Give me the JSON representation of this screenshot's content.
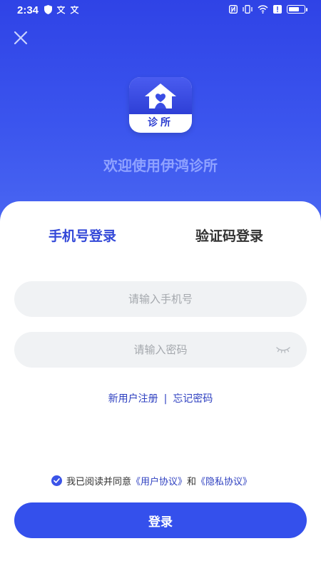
{
  "status_bar": {
    "time": "2:34",
    "left_icons": [
      "shield-icon",
      "translate-icon",
      "translate-icon"
    ],
    "right_icons": [
      "nfc-icon",
      "vibrate-icon",
      "wifi-icon",
      "alert-icon",
      "battery-icon"
    ]
  },
  "colors": {
    "brand_blue": "#3450ec",
    "tab_active": "#3348d8",
    "link": "#2d3fc0"
  },
  "header": {
    "close_icon": "close-icon",
    "logo_text": "诊所",
    "welcome": "欢迎使用伊鸿诊所"
  },
  "tabs": {
    "phone_login": "手机号登录",
    "code_login": "验证码登录",
    "active": "phone_login"
  },
  "form": {
    "phone_placeholder": "请输入手机号",
    "phone_value": "",
    "password_placeholder": "请输入密码",
    "password_value": ""
  },
  "links": {
    "register": "新用户注册",
    "separator": "|",
    "forgot": "忘记密码"
  },
  "agreement": {
    "checked": true,
    "prefix": "我已阅读并同意",
    "user_agreement": "《用户协议》",
    "and": "和",
    "privacy_agreement": "《隐私协议》"
  },
  "login_button": "登录"
}
